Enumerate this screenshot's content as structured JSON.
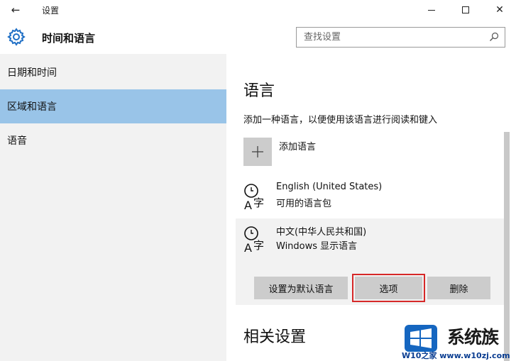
{
  "window": {
    "title": "设置",
    "back_icon": "back-arrow-icon",
    "minimize_icon": "minimize-icon",
    "maximize_icon": "maximize-icon",
    "close_icon": "close-icon",
    "close_glyph": "✕",
    "back_glyph": "←"
  },
  "header": {
    "icon": "gear-icon",
    "title": "时间和语言",
    "search_placeholder": "查找设置",
    "search_icon": "search-icon"
  },
  "sidebar": {
    "items": [
      {
        "label": "日期和时间",
        "selected": false
      },
      {
        "label": "区域和语言",
        "selected": true
      },
      {
        "label": "语音",
        "selected": false
      }
    ]
  },
  "main": {
    "language_section_title": "语言",
    "language_description": "添加一种语言，以便使用该语言进行阅读和键入",
    "add_language_label": "添加语言",
    "add_language_icon": "plus-icon",
    "languages": [
      {
        "name": "English (United States)",
        "status": "可用的语言包",
        "icon": "language-icon"
      },
      {
        "name": "中文(中华人民共和国)",
        "status": "Windows 显示语言",
        "icon": "language-icon"
      }
    ],
    "buttons": {
      "set_default": "设置为默认语言",
      "options": "选项",
      "remove": "删除"
    },
    "related_section_title": "相关设置"
  },
  "watermark": {
    "brand": "系统族",
    "url": "W10之家 www.w10zj.com"
  },
  "colors": {
    "selected_nav": "#99c4e8",
    "sidebar_bg": "#f2f2f2",
    "button_bg": "#cccccc",
    "highlight_border": "#d62828"
  }
}
